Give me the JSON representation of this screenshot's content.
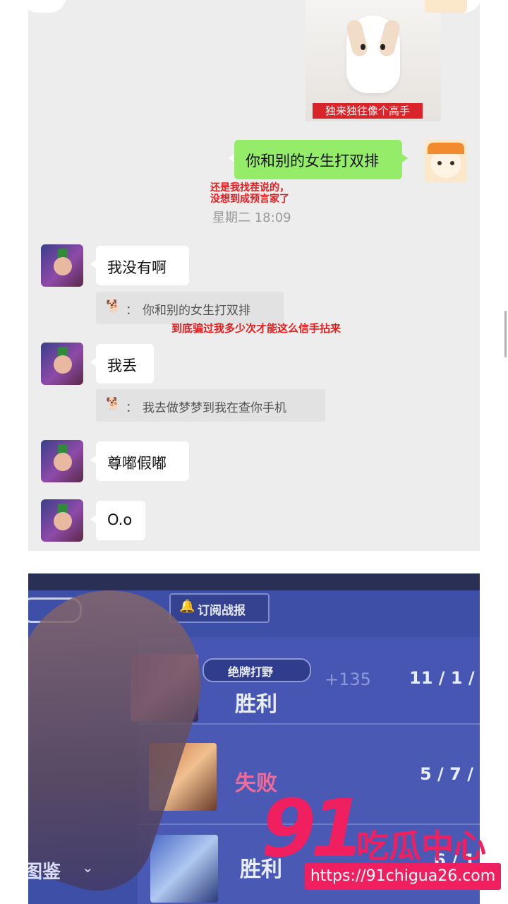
{
  "chat": {
    "sticker_caption": "独来独往像个高手",
    "sent_message": "你和别的女生打双排",
    "annotation_1_line1": "还是我找茬说的，",
    "annotation_1_line2": "没想到成预言家了",
    "timestamp": "星期二 18:09",
    "messages": [
      {
        "text": "我没有啊",
        "quote": "你和别的女生打双排"
      },
      {
        "text": "我丢",
        "quote": "我去做梦梦到我在查你手机"
      },
      {
        "text": "尊嘟假嘟"
      },
      {
        "text": "O.o"
      }
    ],
    "annotation_2": "到底骗过我多少次才能这么信手拈来",
    "quote_colon": "："
  },
  "game": {
    "subscribe_label": "订阅战报",
    "badge_label": "绝牌打野",
    "rows": [
      {
        "result": "胜利",
        "score": "+135",
        "kda": "11 / 1 /",
        "result_color": "#e8eefc"
      },
      {
        "result": "失败",
        "kda": "5 / 7 /",
        "result_color": "#f06a9a"
      },
      {
        "result": "胜利",
        "kda": "6 / 1",
        "result_color": "#e8eefc"
      }
    ],
    "side_label": "图鉴"
  },
  "watermark": {
    "number": "91",
    "name": "吃瓜中心",
    "url": "https://91chigua26.com"
  },
  "colors": {
    "chat_bg": "#ededed",
    "sent_bubble": "#95ec69",
    "annotation_red": "#e31e1e",
    "watermark_pink": "#f02060",
    "game_bg": "#3d4fa6"
  }
}
